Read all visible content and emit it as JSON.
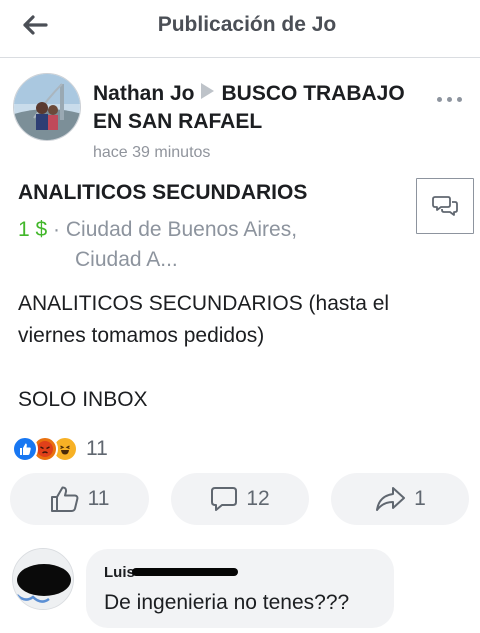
{
  "header": {
    "title": "Publicación de Jo",
    "back_icon": "arrow-left-icon"
  },
  "post": {
    "author": "Nathan Jo",
    "group": "BUSCO TRABAJO EN SAN RAFAEL",
    "time": "hace 39 minutos",
    "item_title": "ANALITICOS SECUNDARIOS",
    "price": "1 $",
    "separator": " · ",
    "location_line1": "Ciudad de Buenos Aires,",
    "location_line2": "Ciudad A...",
    "body_line1": "ANALITICOS SECUNDARIOS (hasta el",
    "body_line2": "viernes tomamos pedidos)",
    "body_line3": "SOLO INBOX"
  },
  "reactions": {
    "count": "11",
    "types": [
      "like",
      "angry",
      "haha"
    ]
  },
  "actions": {
    "likes": "11",
    "comments": "12",
    "shares": "1"
  },
  "comment": {
    "author": "Luis",
    "text": "De ingenieria no tenes???"
  },
  "colors": {
    "price": "#42b72a",
    "like": "#1877f2",
    "pill_bg": "#f2f3f5",
    "muted": "#8d949e"
  }
}
